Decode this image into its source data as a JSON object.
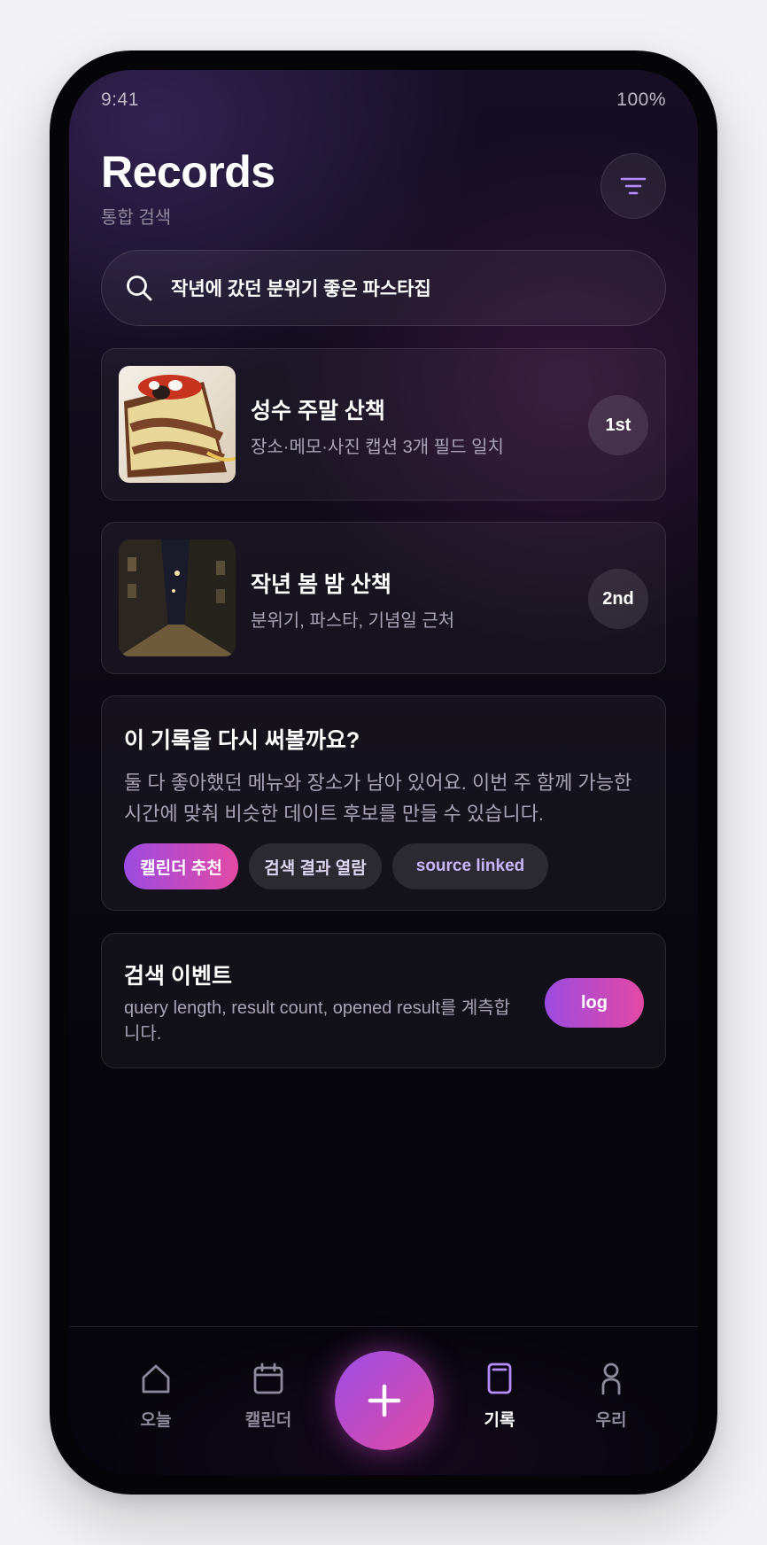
{
  "status": {
    "time": "9:41",
    "battery": "100%"
  },
  "header": {
    "title": "Records",
    "subtitle": "통합 검색"
  },
  "search": {
    "query": "작년에 갔던 분위기 좋은 파스타집"
  },
  "results": [
    {
      "title": "성수 주말 산책",
      "description": "장소·메모·사진 캡션 3개 필드 일치",
      "rank": "1st",
      "thumbnail": "cake-photo"
    },
    {
      "title": "작년 봄 밤 산책",
      "description": "분위기, 파스타, 기념일 근처",
      "rank": "2nd",
      "thumbnail": "night-alley-photo"
    }
  ],
  "suggestion": {
    "title": "이 기록을 다시 써볼까요?",
    "body": "둘 다 좋아했던 메뉴와 장소가 남아 있어요. 이번 주 함께 가능한 시간에 맞춰 비슷한 데이트 후보를 만들 수 있습니다.",
    "chips": [
      "캘린더 추천",
      "검색 결과 열람",
      "source linked"
    ]
  },
  "event": {
    "title": "검색 이벤트",
    "description": "query length, result count, opened result를 계측합니다.",
    "button": "log"
  },
  "nav": {
    "items": [
      {
        "label": "오늘",
        "icon": "home-icon"
      },
      {
        "label": "캘린더",
        "icon": "calendar-icon"
      },
      {
        "label": "기록",
        "icon": "bookmark-icon",
        "active": true
      },
      {
        "label": "우리",
        "icon": "person-icon"
      }
    ],
    "fab_icon": "plus-icon"
  },
  "colors": {
    "accent_start": "#9b4be0",
    "accent_end": "#e34aa4",
    "background": "#0c0914",
    "muted_text": "#a9a3b6"
  }
}
